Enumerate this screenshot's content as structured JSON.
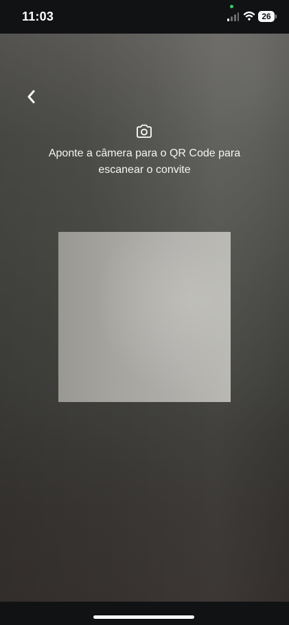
{
  "status_bar": {
    "time": "11:03",
    "battery_level": "26",
    "signal_icon": "signal-icon",
    "wifi_icon": "wifi-icon",
    "privacy_indicator_color": "#2fd35b"
  },
  "scanner": {
    "back_icon": "chevron-left-icon",
    "camera_icon": "camera-icon",
    "instruction_line_1": "Aponte a câmera para o QR Code para",
    "instruction_line_2": "escanear o convite"
  },
  "colors": {
    "text": "#f5f5f2",
    "bars": "#111214",
    "scan_area": "#aeaca8"
  }
}
